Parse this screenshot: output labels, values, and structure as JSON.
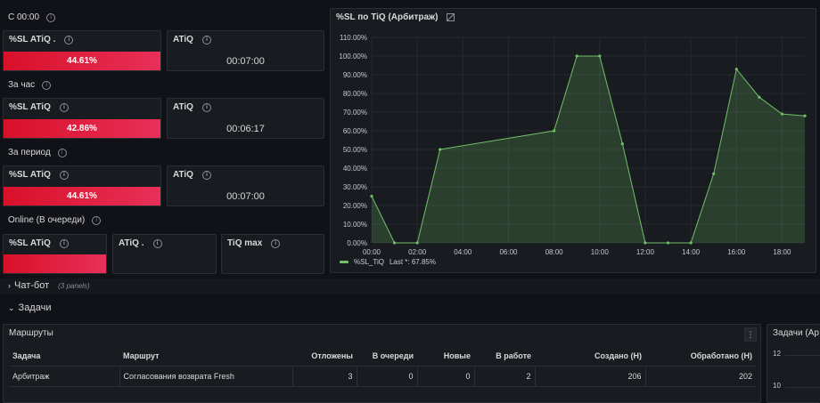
{
  "stats": {
    "sections": [
      {
        "label": "С 00:00",
        "sl_title": "%SL ATiQ .",
        "sl_value": "44.61%",
        "atiq_title": "ATiQ",
        "atiq_value": "00:07:00"
      },
      {
        "label": "За час",
        "sl_title": "%SL ATiQ",
        "sl_value": "42.86%",
        "atiq_title": "ATiQ",
        "atiq_value": "00:06:17"
      },
      {
        "label": "За период",
        "sl_title": "%SL ATiQ",
        "sl_value": "44.61%",
        "atiq_title": "ATiQ",
        "atiq_value": "00:07:00"
      }
    ],
    "online": {
      "label": "Online (В очереди)",
      "sl_title": "%SL ATiQ",
      "atiq_title": "ATiQ .",
      "tiqmax_title": "TiQ max"
    }
  },
  "chart_panel": {
    "title": "%SL по TiQ (Арбитраж)",
    "legend_label": "%SL_TiQ",
    "legend_last": "Last *: 67.85%"
  },
  "chart_data": {
    "type": "area",
    "series": [
      {
        "name": "%SL_TiQ",
        "color": "#73bf69",
        "x": [
          0,
          1,
          2,
          3,
          8,
          9,
          10,
          11,
          12,
          13,
          14,
          15,
          16,
          17,
          18,
          19
        ],
        "values": [
          25,
          0,
          0,
          50,
          60,
          100,
          100,
          53,
          0,
          0,
          0,
          37,
          93,
          78,
          69,
          68
        ]
      }
    ],
    "xlim": [
      0,
      19
    ],
    "ylim": [
      0,
      110
    ],
    "x_ticks": [
      "00:00",
      "02:00",
      "04:00",
      "06:00",
      "08:00",
      "10:00",
      "12:00",
      "14:00",
      "16:00",
      "18:00"
    ],
    "y_ticks": [
      "0.00%",
      "10.00%",
      "20.00%",
      "30.00%",
      "40.00%",
      "50.00%",
      "60.00%",
      "70.00%",
      "80.00%",
      "90.00%",
      "100.00%",
      "110.00%"
    ],
    "grid": true,
    "legend": "bottom-left"
  },
  "rows": {
    "chatbot": {
      "title": "Чат-бот",
      "note": "(3 panels)"
    },
    "tasks": {
      "title": "Задачи"
    }
  },
  "routes": {
    "title": "Маршруты",
    "columns": [
      "Задача",
      "Маршрут",
      "Отложены",
      "В очереди",
      "Новые",
      "В работе",
      "Создано (Н)",
      "Обработано (Н)"
    ],
    "rows": [
      [
        "Арбитраж",
        "Согласования возврата Fresh",
        "3",
        "0",
        "0",
        "2",
        "206",
        "202"
      ]
    ]
  },
  "tasks_panel": {
    "title": "Задачи (Ар",
    "y_ticks": [
      "12",
      "10"
    ]
  }
}
